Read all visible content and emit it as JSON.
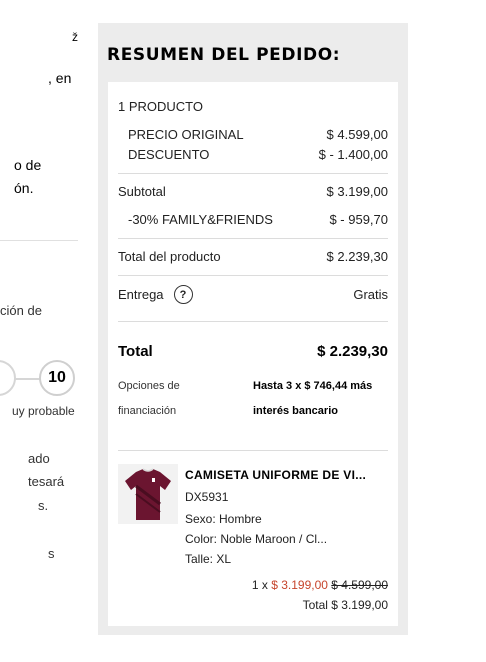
{
  "left_fragments": {
    "f1": "ž",
    "f2": ", en",
    "f3": "o de",
    "f4": "ón.",
    "f5": "ción de",
    "scale_value": "10",
    "f6": "uy probable",
    "f7": "ado",
    "f8": "tesará",
    "f9": "s.",
    "f10": "s"
  },
  "summary": {
    "title": "RESUMEN DEL PEDIDO:",
    "product_count": "1 PRODUCTO",
    "original_price_label": "PRECIO ORIGINAL",
    "original_price_value": "$ 4.599,00",
    "discount_label": "DESCUENTO",
    "discount_value": "$ - 1.400,00",
    "subtotal_label": "Subtotal",
    "subtotal_value": "$ 3.199,00",
    "promo_label": "-30% FAMILY&FRIENDS",
    "promo_value": "$ - 959,70",
    "product_total_label": "Total del producto",
    "product_total_value": "$ 2.239,30",
    "delivery_label": "Entrega",
    "delivery_help": "?",
    "delivery_value": "Gratis",
    "total_label": "Total",
    "total_value": "$ 2.239,30",
    "financing_label_1": "Opciones de",
    "financing_label_2": "financiación",
    "financing_value_1": "Hasta 3 x $ 746,44 más",
    "financing_value_2": "interés bancario"
  },
  "product": {
    "name": "CAMISETA UNIFORME DE VI...",
    "sku": "DX5931",
    "gender": "Sexo: Hombre",
    "color": "Color: Noble Maroon / Cl...",
    "size": "Talle: XL",
    "qty_prefix": "1 x",
    "sale_price": "$ 3.199,00",
    "original_price": "$ 4.599,00",
    "line_total": "Total $ 3.199,00"
  },
  "colors": {
    "sale": "#c6452c",
    "panel_bg": "#ececec",
    "jersey": "#6b1530"
  }
}
